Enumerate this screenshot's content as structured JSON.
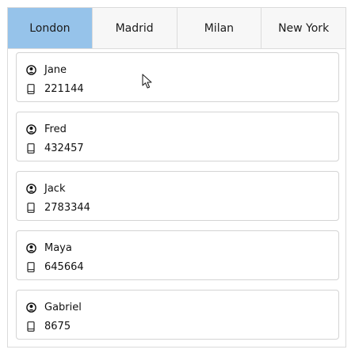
{
  "tabs": [
    {
      "label": "London",
      "selected": true
    },
    {
      "label": "Madrid",
      "selected": false
    },
    {
      "label": "Milan",
      "selected": false
    },
    {
      "label": "New York",
      "selected": false
    }
  ],
  "contacts": [
    {
      "name": "Jane",
      "phone": "221144"
    },
    {
      "name": "Fred",
      "phone": "432457"
    },
    {
      "name": "Jack",
      "phone": "2783344"
    },
    {
      "name": "Maya",
      "phone": "645664"
    },
    {
      "name": "Gabriel",
      "phone": "8675"
    }
  ],
  "icons": {
    "person": "person-icon",
    "phone": "phone-icon",
    "cursor": "mouse-cursor-icon"
  },
  "colors": {
    "selected_tab": "#96c3ea",
    "tab_background": "#f7f7f7"
  }
}
